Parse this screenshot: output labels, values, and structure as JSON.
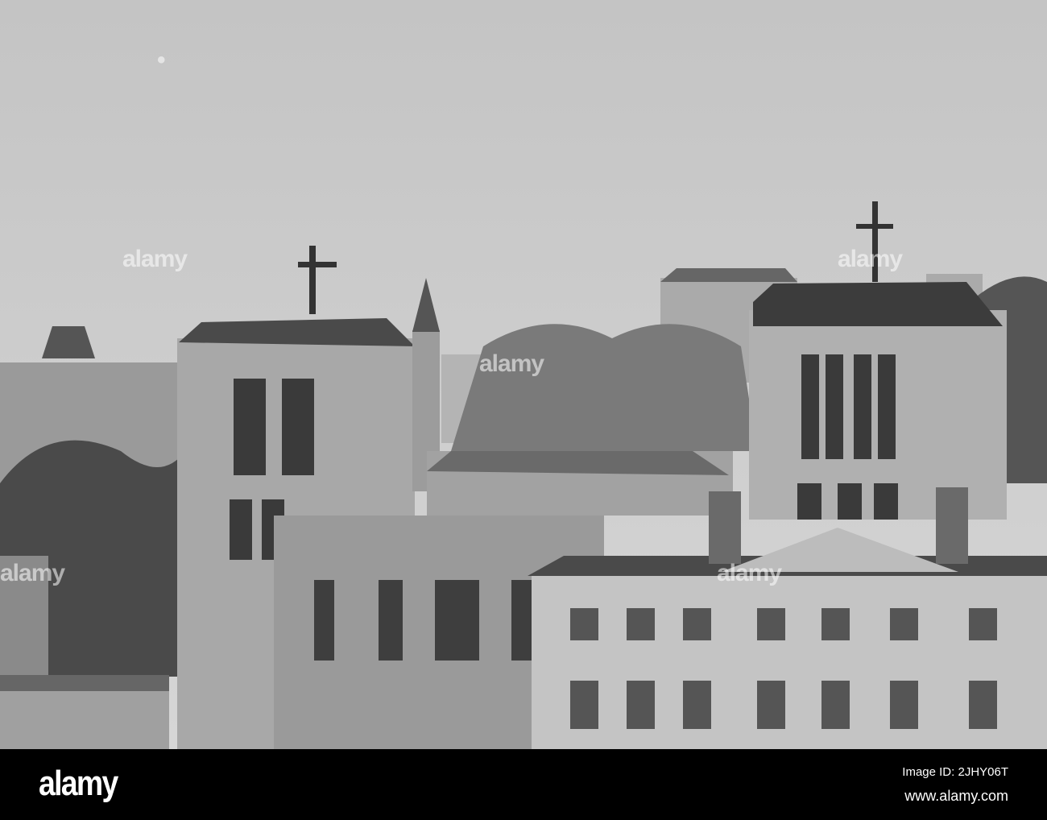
{
  "photo": {
    "subject": "Cathedral towers with crosses in black and white",
    "watermark_text": "alamy"
  },
  "footer": {
    "logo": "alamy",
    "image_id": "Image ID: 2JHY06T",
    "website": "www.alamy.com"
  }
}
